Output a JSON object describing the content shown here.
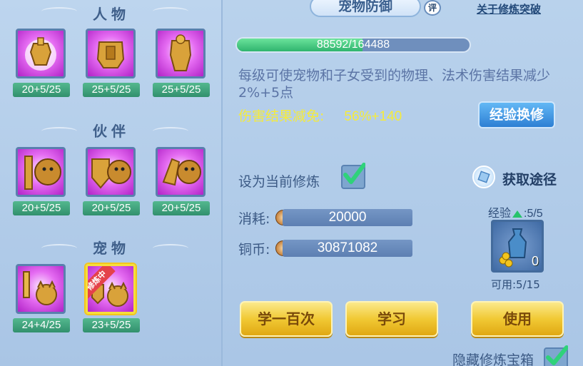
{
  "left": {
    "sections": [
      {
        "title": "人物",
        "slots": [
          {
            "level": "20+5/25",
            "fraction": 1.0
          },
          {
            "level": "25+5/25",
            "fraction": 1.0
          },
          {
            "level": "25+5/25",
            "fraction": 1.0
          }
        ]
      },
      {
        "title": "伙伴",
        "slots": [
          {
            "level": "20+5/25",
            "fraction": 1.0
          },
          {
            "level": "20+5/25",
            "fraction": 1.0
          },
          {
            "level": "20+5/25",
            "fraction": 1.0
          }
        ]
      },
      {
        "title": "宠物",
        "slots": [
          {
            "level": "24+4/25",
            "fraction": 1.0
          },
          {
            "level": "23+5/25",
            "fraction": 1.0,
            "ribbon": "修炼中",
            "selected": true
          }
        ]
      }
    ]
  },
  "right": {
    "title": "宠物防御",
    "rate_badge": "评",
    "about_link": "关于修炼突破",
    "progress": {
      "text": "88592/164488",
      "fraction": 0.5386
    },
    "description": "每级可使宠物和子女受到的物理、法术伤害结果减少2%+5点",
    "reduction_label": "伤害结果减免:",
    "reduction_value": "56%+140",
    "exchange_button": "经验换修",
    "set_current_label": "设为当前修炼",
    "get_source_label": "获取途径",
    "cost_label": "消耗:",
    "cost_value": "20000",
    "copper_label": "铜币:",
    "copper_value": "30871082",
    "exp_label": "经验",
    "exp_value": ":5/5",
    "item_count": "0",
    "available_label": "可用:5/15",
    "buttons": {
      "learn100": "学一百次",
      "learn": "学习",
      "use": "使用"
    },
    "hide_label": "隐藏修炼宝箱"
  },
  "colors": {
    "accent_gold": "#f1c934",
    "accent_blue": "#2d7fd4",
    "highlight_yellow": "#f5eb3a",
    "progress_green": "#2fb46e"
  }
}
